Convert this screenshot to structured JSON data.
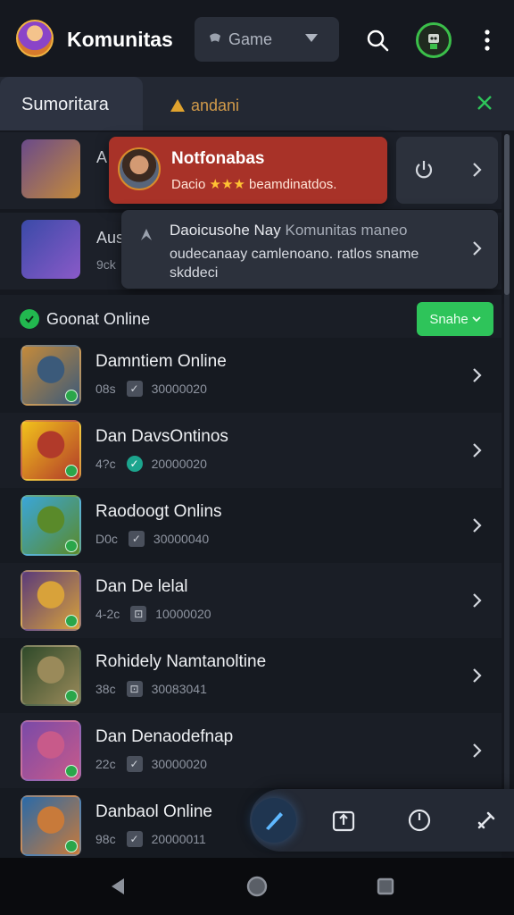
{
  "header": {
    "title": "Komunitas",
    "game_select": {
      "value": "Game"
    }
  },
  "tabs": [
    {
      "label": "Sumoritara"
    },
    {
      "label": "andani"
    }
  ],
  "background_rows": [
    {
      "title": "A",
      "sub": ""
    },
    {
      "title": "Aus",
      "sub": "9ck"
    }
  ],
  "notifications": {
    "primary": {
      "title": "Notfonabas",
      "body_prefix": "Dacio",
      "stars": "★★★",
      "body_suffix": "beamdinatdos."
    },
    "secondary": {
      "title": "Daoicusohe Nay",
      "title_muted": "Komunitas maneo",
      "body": "oudecanaay camlenoano. ratlos sname skddeci"
    }
  },
  "online_section": {
    "title": "Goonat Online",
    "filter_label": "Snahe"
  },
  "games": [
    {
      "name": "Damntiem Online",
      "count": "08s",
      "check": "✓",
      "check_style": "box",
      "players": "30000020",
      "colors": [
        "#c48a3a",
        "#3b5a7a"
      ]
    },
    {
      "name": "Dan DavsOntinos",
      "count": "4?c",
      "check": "✓",
      "check_style": "ok",
      "players": "20000020",
      "colors": [
        "#f2c21b",
        "#b13a2a"
      ]
    },
    {
      "name": "Raodoogt Onlins",
      "count": "D0c",
      "check": "✓",
      "check_style": "box",
      "players": "30000040",
      "colors": [
        "#3aa6d8",
        "#5a8a2a"
      ]
    },
    {
      "name": "Dan De lelal",
      "count": "4-2c",
      "check": "⊡",
      "check_style": "box",
      "players": "10000020",
      "colors": [
        "#5a3a7a",
        "#d8a23a"
      ]
    },
    {
      "name": "Rohidely Namtanoltine",
      "count": "38c",
      "check": "⊡",
      "check_style": "box",
      "players": "30083041",
      "colors": [
        "#2f4a2a",
        "#9a8a5a"
      ]
    },
    {
      "name": "Dan Denaodefnap",
      "count": "22c",
      "check": "✓",
      "check_style": "box",
      "players": "30000020",
      "colors": [
        "#7a4aa8",
        "#c85a8a"
      ]
    },
    {
      "name": "Danbaol Online",
      "count": "98c",
      "check": "✓",
      "check_style": "box",
      "players": "20000011",
      "colors": [
        "#2a6aa8",
        "#c87a3a"
      ]
    }
  ],
  "colors": {
    "accent_green": "#2ec45a",
    "notification_red": "#a83228",
    "background": "#15181f"
  },
  "dock": [
    "edit-icon",
    "upload-icon",
    "clock-icon",
    "tools-icon"
  ],
  "system_nav": [
    "back-icon",
    "home-icon",
    "recents-icon"
  ]
}
